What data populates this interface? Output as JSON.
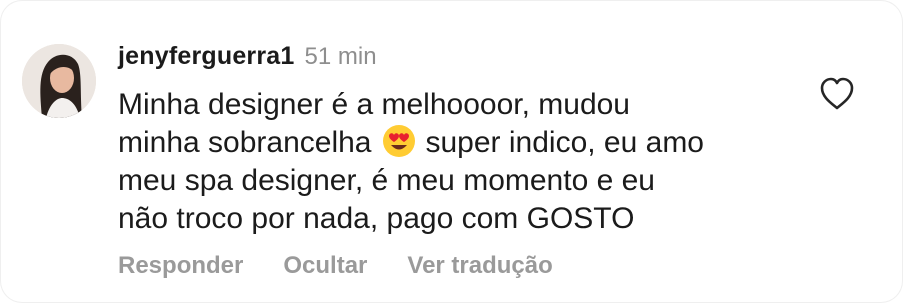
{
  "comment": {
    "username": "jenyferguerra1",
    "time": "51 min",
    "text_lines": [
      "Minha designer é a melhoooor, mudou",
      "minha sobrancelha",
      "super indico, eu amo",
      "meu spa designer, é meu momento e eu",
      "não troco por nada, pago com GOSTO"
    ],
    "inline_emoji": "heart-eyes-emoji",
    "actions": {
      "reply": "Responder",
      "hide": "Ocultar",
      "translate": "Ver tradução"
    },
    "like_icon": "heart-outline-icon"
  },
  "colors": {
    "text": "#1b1b1b",
    "secondary": "#8e8e8e",
    "action": "#9a9a9a",
    "background": "#ffffff"
  }
}
